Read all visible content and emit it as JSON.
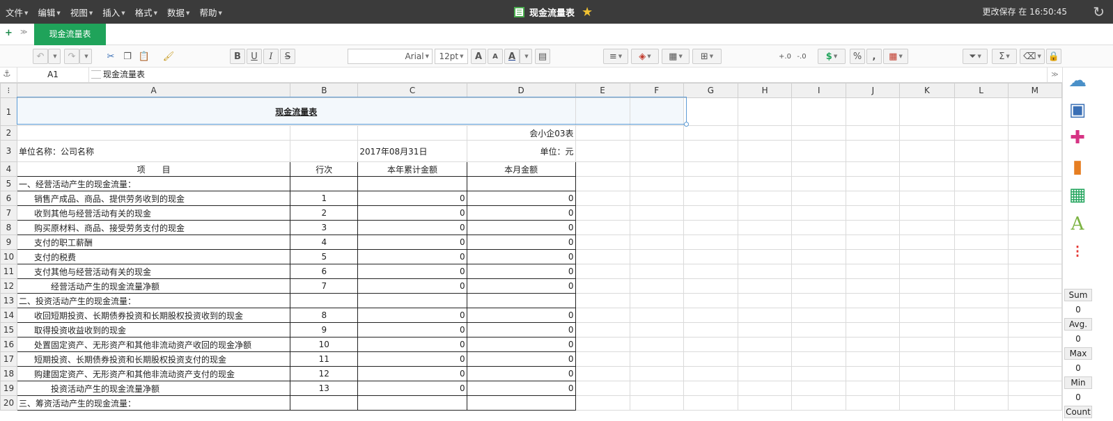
{
  "menu": {
    "items": [
      "文件",
      "编辑",
      "视图",
      "插入",
      "格式",
      "数据",
      "帮助"
    ],
    "doc_title": "现金流量表",
    "save_status": "更改保存 在 16:50:45"
  },
  "tabs": {
    "add": "+",
    "list": "≫",
    "active": "现金流量表"
  },
  "toolbar": {
    "font_name": "Arial",
    "font_size": "12pt",
    "bold": "B",
    "underline": "U",
    "italic": "I",
    "strike": "S",
    "percent": "%",
    "comma": ",",
    "dollar": "$",
    "sigma": "Σ"
  },
  "formula": {
    "cell_ref": "A1",
    "content": "现金流量表"
  },
  "columns": [
    "A",
    "B",
    "C",
    "D",
    "E",
    "F",
    "G",
    "H",
    "I",
    "J",
    "K",
    "L",
    "M"
  ],
  "sheet": {
    "title": "现金流量表",
    "form_no": "会小企03表",
    "company": "单位名称：公司名称",
    "date": "2017年08月31日",
    "unit": "单位：元",
    "headers": [
      "项　　目",
      "行次",
      "本年累计金额",
      "本月金额"
    ],
    "rows": [
      {
        "num": "5",
        "item": "一、经营活动产生的现金流量：",
        "line": "",
        "ytd": "",
        "month": "",
        "indent": 0
      },
      {
        "num": "6",
        "item": "销售产成品、商品、提供劳务收到的现金",
        "line": "1",
        "ytd": "0",
        "month": "0",
        "indent": 1
      },
      {
        "num": "7",
        "item": "收到其他与经营活动有关的现金",
        "line": "2",
        "ytd": "0",
        "month": "0",
        "indent": 1
      },
      {
        "num": "8",
        "item": "购买原材料、商品、接受劳务支付的现金",
        "line": "3",
        "ytd": "0",
        "month": "0",
        "indent": 1
      },
      {
        "num": "9",
        "item": "支付的职工薪酬",
        "line": "4",
        "ytd": "0",
        "month": "0",
        "indent": 1
      },
      {
        "num": "10",
        "item": "支付的税费",
        "line": "5",
        "ytd": "0",
        "month": "0",
        "indent": 1
      },
      {
        "num": "11",
        "item": "支付其他与经营活动有关的现金",
        "line": "6",
        "ytd": "0",
        "month": "0",
        "indent": 1
      },
      {
        "num": "12",
        "item": "经营活动产生的现金流量净额",
        "line": "7",
        "ytd": "0",
        "month": "0",
        "indent": 2
      },
      {
        "num": "13",
        "item": "二、投资活动产生的现金流量：",
        "line": "",
        "ytd": "",
        "month": "",
        "indent": 0
      },
      {
        "num": "14",
        "item": "收回短期投资、长期债券投资和长期股权投资收到的现金",
        "line": "8",
        "ytd": "0",
        "month": "0",
        "indent": 1
      },
      {
        "num": "15",
        "item": "取得投资收益收到的现金",
        "line": "9",
        "ytd": "0",
        "month": "0",
        "indent": 1
      },
      {
        "num": "16",
        "item": "处置固定资产、无形资产和其他非流动资产收回的现金净额",
        "line": "10",
        "ytd": "0",
        "month": "0",
        "indent": 1
      },
      {
        "num": "17",
        "item": "短期投资、长期债券投资和长期股权投资支付的现金",
        "line": "11",
        "ytd": "0",
        "month": "0",
        "indent": 1
      },
      {
        "num": "18",
        "item": "购建固定资产、无形资产和其他非流动资产支付的现金",
        "line": "12",
        "ytd": "0",
        "month": "0",
        "indent": 1
      },
      {
        "num": "19",
        "item": "投资活动产生的现金流量净额",
        "line": "13",
        "ytd": "0",
        "month": "0",
        "indent": 2
      },
      {
        "num": "20",
        "item": "三、筹资活动产生的现金流量：",
        "line": "",
        "ytd": "",
        "month": "",
        "indent": 0
      }
    ]
  },
  "stats": [
    {
      "label": "Sum",
      "value": "0"
    },
    {
      "label": "Avg.",
      "value": "0"
    },
    {
      "label": "Max",
      "value": "0"
    },
    {
      "label": "Min",
      "value": "0"
    },
    {
      "label": "Count",
      "value": ""
    }
  ]
}
